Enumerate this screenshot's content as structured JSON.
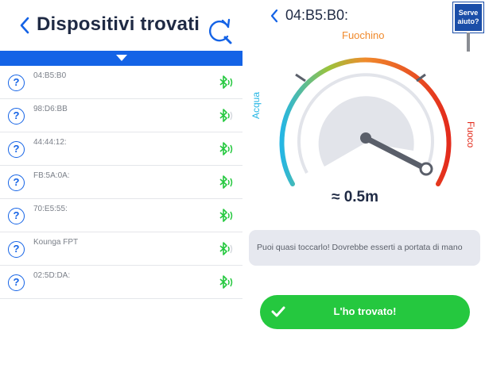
{
  "left_screen": {
    "title": "Dispositivi trovati",
    "devices": [
      {
        "name": "04:B5:B0",
        "signal": "strong"
      },
      {
        "name": "98:D6:BB",
        "signal": "weak"
      },
      {
        "name": "44:44:12:",
        "signal": "strong"
      },
      {
        "name": "FB:5A:0A:",
        "signal": "strong"
      },
      {
        "name": "70:E5:55:",
        "signal": "strong"
      },
      {
        "name": "Kounga FPT",
        "signal": "weak"
      },
      {
        "name": "02:5D:DA:",
        "signal": "strong"
      }
    ]
  },
  "right_screen": {
    "title": "04:B5:B0:",
    "help_sign": {
      "line1": "Serve",
      "line2": "aiuto?"
    },
    "gauge": {
      "label_top": "Fuochino",
      "label_left": "Acqua",
      "label_right": "Fuoco"
    },
    "distance": "≈ 0.5m",
    "message": "Puoi quasi toccarlo! Dovrebbe esserti a portata di mano",
    "found_button_label": "L'ho trovato!"
  },
  "colors": {
    "brand_blue": "#1463e6",
    "bluetooth_green": "#25c83f",
    "accent_orange": "#f08a2c",
    "water_blue": "#25b6e4",
    "fire_red": "#e32b1c"
  }
}
